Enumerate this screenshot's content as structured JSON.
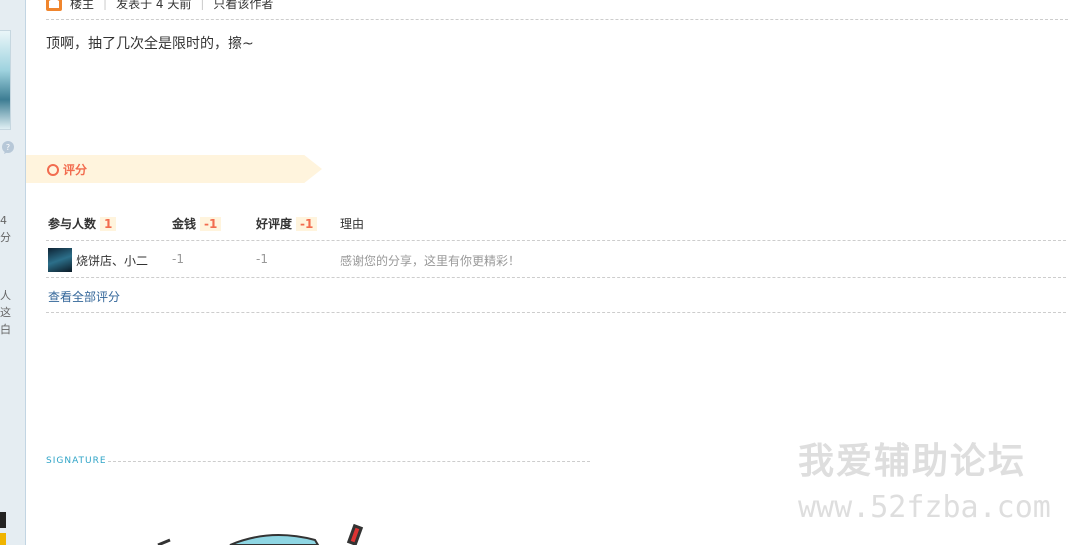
{
  "left_column": {
    "fragment_chars": [
      "4",
      "分",
      "人",
      "这",
      "白"
    ]
  },
  "post": {
    "author_tag": "楼主",
    "posted_time": "发表于 4 天前",
    "only_author_link": "只看该作者",
    "body": "顶啊，抽了几次全是限时的，擦~"
  },
  "rating": {
    "title": "评分",
    "headers": {
      "participants_label": "参与人数",
      "participants_count": "1",
      "money_label": "金钱",
      "money_total": "-1",
      "reputation_label": "好评度",
      "reputation_total": "-1",
      "reason_label": "理由"
    },
    "rows": [
      {
        "user": "烧饼店、小二",
        "money": "-1",
        "reputation": "-1",
        "reason": "感谢您的分享，这里有你更精彩！"
      }
    ],
    "view_all": "查看全部评分"
  },
  "signature": {
    "label": "SIGNATURE"
  },
  "watermark": {
    "title": "我爱辅助论坛",
    "url": "www.52fzba.com"
  },
  "colors": {
    "accent": "#f26c4f",
    "link": "#336699",
    "ribbon_bg": "#fff4dd",
    "sidebar_bg": "#e5edf2",
    "signature": "#2fa4c7"
  },
  "icons": [
    "owner-icon",
    "speech-bubble-icon",
    "rating-circle-icon"
  ]
}
